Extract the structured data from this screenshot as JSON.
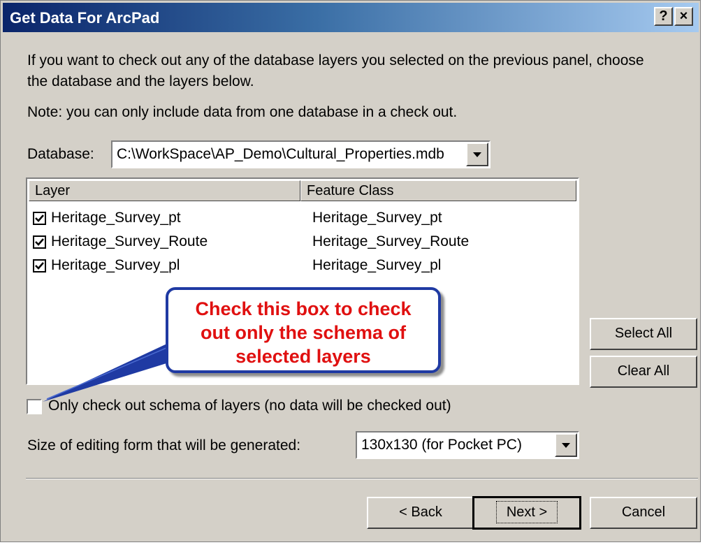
{
  "window": {
    "title": "Get Data For ArcPad",
    "help_label": "?",
    "close_label": "×"
  },
  "intro": {
    "line1": "If you want to check out any of the database layers you selected on the previous panel, choose",
    "line2": "the database and the layers below.",
    "note": "Note: you can only include data from one database in a check out."
  },
  "database": {
    "label": "Database:",
    "value": "C:\\WorkSpace\\AP_Demo\\Cultural_Properties.mdb"
  },
  "layers_table": {
    "columns": [
      "Layer",
      "Feature Class"
    ],
    "rows": [
      {
        "layer": "Heritage_Survey_pt",
        "feature_class": "Heritage_Survey_pt",
        "checked": true
      },
      {
        "layer": "Heritage_Survey_Route",
        "feature_class": "Heritage_Survey_Route",
        "checked": true
      },
      {
        "layer": "Heritage_Survey_pl",
        "feature_class": "Heritage_Survey_pl",
        "checked": true
      }
    ]
  },
  "callout": {
    "line1": "Check this box to check",
    "line2": "out only the schema of",
    "line3": "selected layers",
    "text_color": "#e01010",
    "border_color": "#1f3aa3"
  },
  "buttons": {
    "select_all": "Select All",
    "clear_all": "Clear All",
    "back": "< Back",
    "next": "Next >",
    "cancel": "Cancel"
  },
  "schema_only": {
    "label": "Only check out schema of layers (no data will be checked out)",
    "checked": false
  },
  "form_size": {
    "label": "Size of editing form that will be generated:",
    "value": "130x130 (for Pocket PC)"
  }
}
